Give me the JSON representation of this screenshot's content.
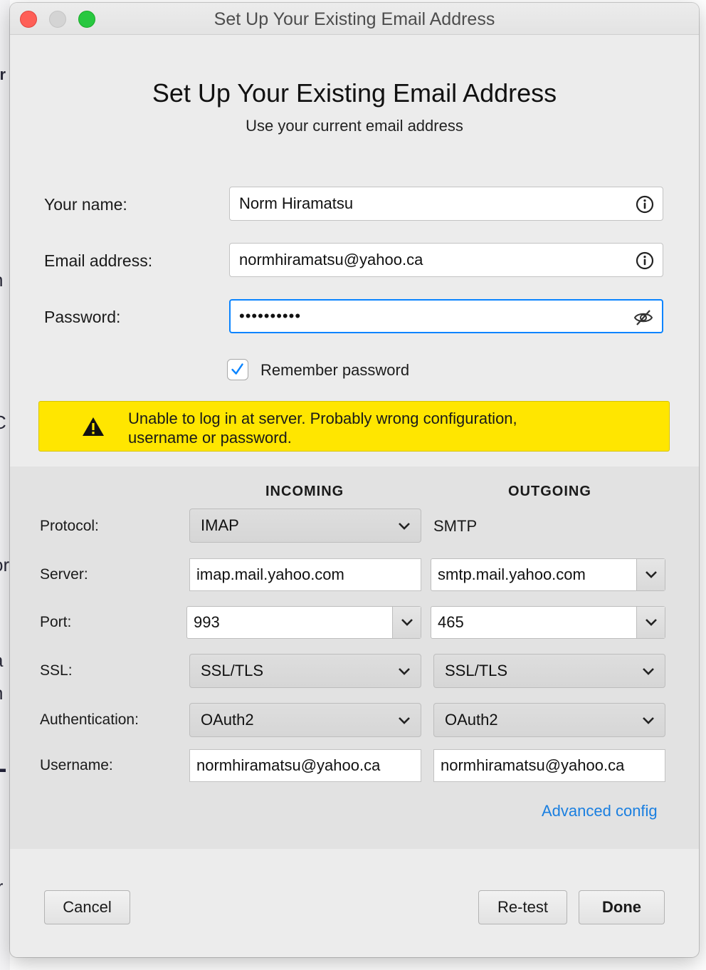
{
  "window": {
    "title": "Set Up Your Existing Email Address"
  },
  "header": {
    "title": "Set Up Your Existing Email Address",
    "subtitle": "Use your current email address"
  },
  "account": {
    "name_label": "Your name:",
    "name_value": "Norm Hiramatsu",
    "email_label": "Email address:",
    "email_value": "normhiramatsu@yahoo.ca",
    "password_label": "Password:",
    "password_masked": "••••••••••",
    "remember_label": "Remember password",
    "remember_checked": true
  },
  "alert": {
    "line1": "Unable to log in at server. Probably wrong configuration,",
    "line2": "username or password.",
    "color": "#ffe600"
  },
  "config": {
    "incoming_header": "INCOMING",
    "outgoing_header": "OUTGOING",
    "labels": {
      "protocol": "Protocol:",
      "server": "Server:",
      "port": "Port:",
      "ssl": "SSL:",
      "authentication": "Authentication:",
      "username": "Username:"
    },
    "incoming": {
      "protocol": "IMAP",
      "server": "imap.mail.yahoo.com",
      "port": "993",
      "ssl": "SSL/TLS",
      "authentication": "OAuth2",
      "username": "normhiramatsu@yahoo.ca"
    },
    "outgoing": {
      "protocol": "SMTP",
      "server": "smtp.mail.yahoo.com",
      "port": "465",
      "ssl": "SSL/TLS",
      "authentication": "OAuth2",
      "username": "normhiramatsu@yahoo.ca"
    },
    "advanced_link": "Advanced config"
  },
  "buttons": {
    "cancel": "Cancel",
    "retest": "Re-test",
    "done": "Done"
  },
  "colors": {
    "accent": "#0a84ff",
    "link": "#1a7fe0"
  }
}
